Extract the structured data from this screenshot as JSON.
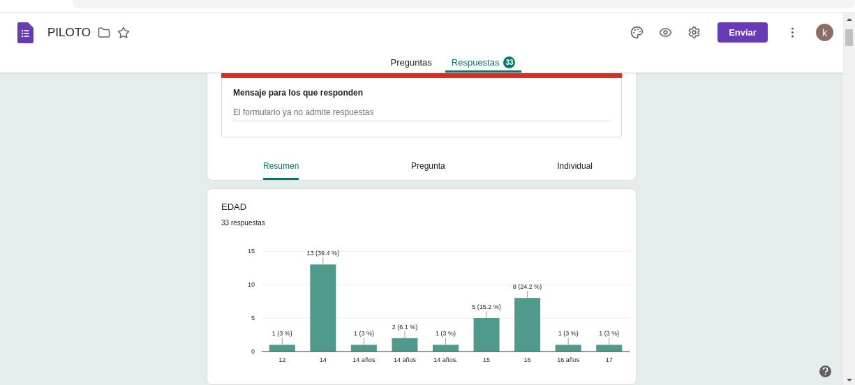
{
  "header": {
    "title": "PILOTO",
    "send_button": "Enviar",
    "avatar": "k"
  },
  "top_tabs": [
    {
      "label": "Preguntas",
      "selected": false
    },
    {
      "label": "Respuestas",
      "selected": true,
      "badge": "33"
    }
  ],
  "closed_message": {
    "label": "Mensaje para los que responden",
    "placeholder": "El formulario ya no admite respuestas"
  },
  "view_tabs": [
    {
      "label": "Resumen",
      "selected": true
    },
    {
      "label": "Pregunta",
      "selected": false
    },
    {
      "label": "Individual",
      "selected": false
    }
  ],
  "question": {
    "title": "EDAD",
    "count": "33 respuestas",
    "chart_data": {
      "type": "bar",
      "categories": [
        "12",
        "14",
        "14 años",
        "14 años",
        "14 años.",
        "15",
        "16",
        "16 años",
        "17"
      ],
      "series": [
        {
          "color": "#4f9a8d",
          "values": [
            1,
            13,
            1,
            2,
            1,
            5,
            8,
            1,
            1
          ]
        }
      ],
      "ylim": [
        0,
        15
      ],
      "yticks": [
        0,
        5,
        10,
        15
      ],
      "value_labels": [
        "1 (3 %)",
        "13 (39.4 %)",
        "1 (3 %)",
        "2 (6.1 %)",
        "1 (3 %)",
        "5 (15.2 %)",
        "8 (24.2 %)",
        "1 (3 %)",
        "1 (3 %)"
      ]
    }
  }
}
